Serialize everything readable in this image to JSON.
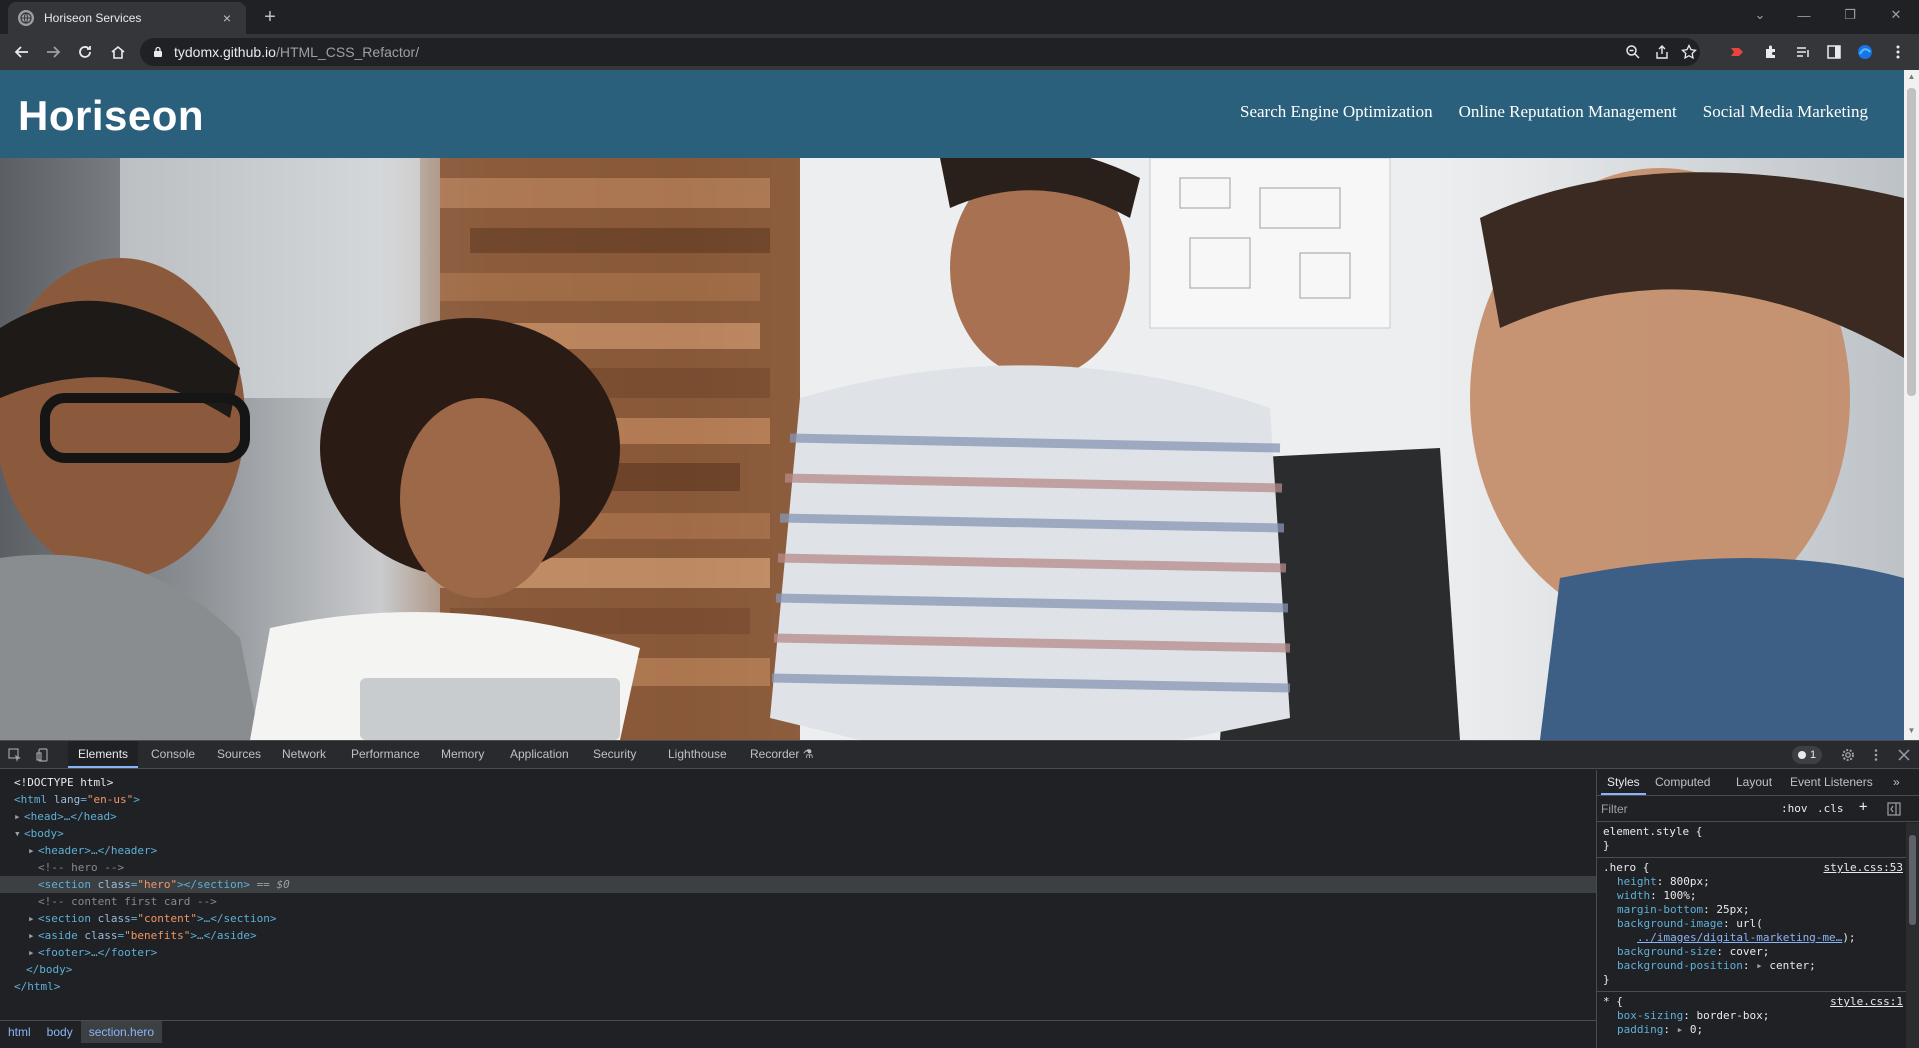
{
  "browser": {
    "tab_title": "Horiseon Services",
    "tab_close": "×",
    "new_tab": "+",
    "url_host": "tydomx.github.io",
    "url_path": "/HTML_CSS_Refactor/"
  },
  "site": {
    "logo": "Horiseon",
    "nav": [
      {
        "label": "Search Engine Optimization"
      },
      {
        "label": "Online Reputation Management"
      },
      {
        "label": "Social Media Marketing"
      }
    ]
  },
  "devtools": {
    "tabs": [
      {
        "label": "Elements"
      },
      {
        "label": "Console"
      },
      {
        "label": "Sources"
      },
      {
        "label": "Network"
      },
      {
        "label": "Performance"
      },
      {
        "label": "Memory"
      },
      {
        "label": "Application"
      },
      {
        "label": "Security"
      },
      {
        "label": "Lighthouse"
      },
      {
        "label": "Recorder"
      }
    ],
    "issues_count": "1",
    "dom": {
      "doctype": "<!DOCTYPE html>",
      "html_open": "<html",
      "lang_attr": "lang",
      "lang_val": "\"en-us\"",
      "head": "<head>…</head>",
      "body_open": "<body>",
      "header": "<header>…</header>",
      "comment_hero": "<!-- hero -->",
      "section_open": "<section",
      "class_attr": "class",
      "hero_val": "\"hero\"",
      "section_close": "></section>",
      "sel_marker": " == ",
      "dollar": "$0",
      "comment_content": "<!-- content first card -->",
      "content_val": "\"content\"",
      "content_close": ">…</section>",
      "aside_open": "<aside",
      "benefits_val": "\"benefits\"",
      "aside_close": ">…</aside>",
      "footer": "<footer>…</footer>",
      "body_close": "</body>",
      "html_close": "</html>"
    },
    "breadcrumbs": [
      {
        "label": "html"
      },
      {
        "label": "body"
      },
      {
        "label": "section.hero"
      }
    ],
    "styles": {
      "tabs": [
        {
          "label": "Styles"
        },
        {
          "label": "Computed"
        },
        {
          "label": "Layout"
        },
        {
          "label": "Event Listeners"
        }
      ],
      "more": "»",
      "filter_placeholder": "Filter",
      "hov": ":hov",
      "cls": ".cls",
      "plus": "+",
      "element_style": "element.style {",
      "close_brace": "}",
      "hero_selector": ".hero {",
      "hero_source": "style.css:53",
      "hero_props": [
        {
          "name": "height",
          "value": "800px;"
        },
        {
          "name": "width",
          "value": "100%;"
        },
        {
          "name": "margin-bottom",
          "value": "25px;"
        },
        {
          "name": "background-image",
          "value": "url("
        }
      ],
      "bg_url": "../images/digital-marketing-me…",
      "bg_url_end": ");",
      "hero_props2": [
        {
          "name": "background-size",
          "value": "cover;"
        },
        {
          "name": "background-position",
          "value": "center;"
        }
      ],
      "star_selector": "* {",
      "star_source": "style.css:1",
      "star_props": [
        {
          "name": "box-sizing",
          "value": "border-box;"
        },
        {
          "name": "padding",
          "value": "0;"
        }
      ]
    }
  },
  "colors": {
    "header_bg": "#2a607c",
    "devtools_bg": "#202124",
    "accent": "#8ab4f8"
  }
}
